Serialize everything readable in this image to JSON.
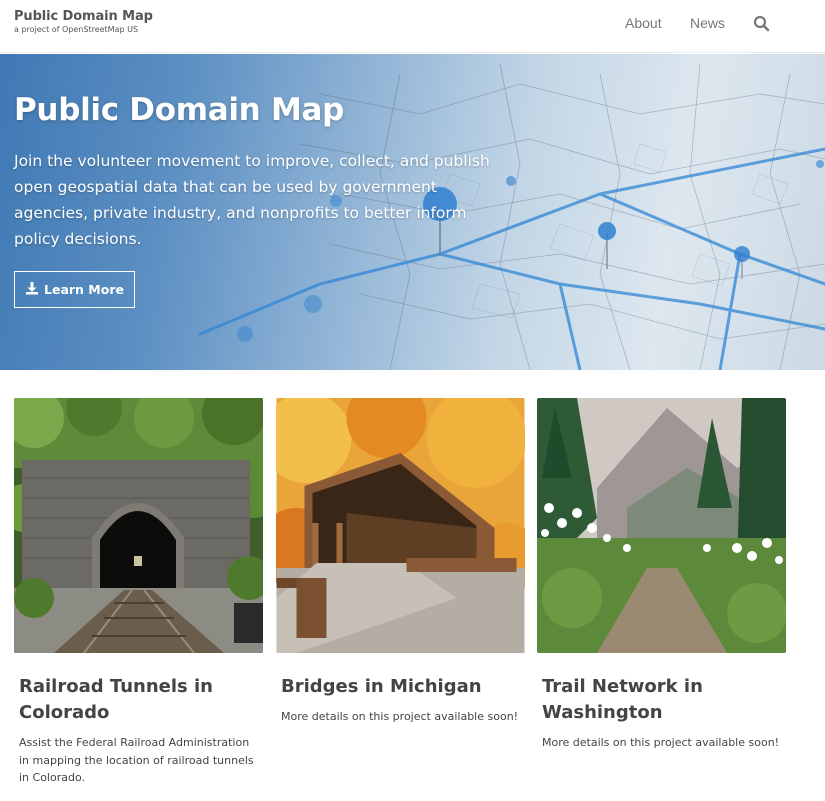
{
  "brand": {
    "title": "Public Domain Map",
    "subtitle": "a project of OpenStreetMap US"
  },
  "nav": {
    "links": [
      "About",
      "News"
    ],
    "search_icon": "search-icon"
  },
  "hero": {
    "title": "Public Domain Map",
    "text": "Join the volunteer movement to improve, collect, and publish open geospatial data that can be used by government agencies, private industry, and nonprofits to better inform policy decisions.",
    "button_label": "Learn More",
    "button_icon": "download-icon"
  },
  "cards": [
    {
      "title": "Railroad Tunnels in Colorado",
      "text": "Assist the Federal Railroad Administration in mapping the location of railroad tunnels in Colorado.",
      "image": "railroad-tunnel-image"
    },
    {
      "title": "Bridges in Michigan",
      "text": "More details on this project available soon!",
      "image": "covered-bridge-image"
    },
    {
      "title": "Trail Network in Washington",
      "text": "More details on this project available soon!",
      "image": "mountain-trail-image"
    }
  ],
  "colors": {
    "hero_blue": "#3f79b4",
    "nav_text": "#777777",
    "brand_text": "#555555"
  }
}
